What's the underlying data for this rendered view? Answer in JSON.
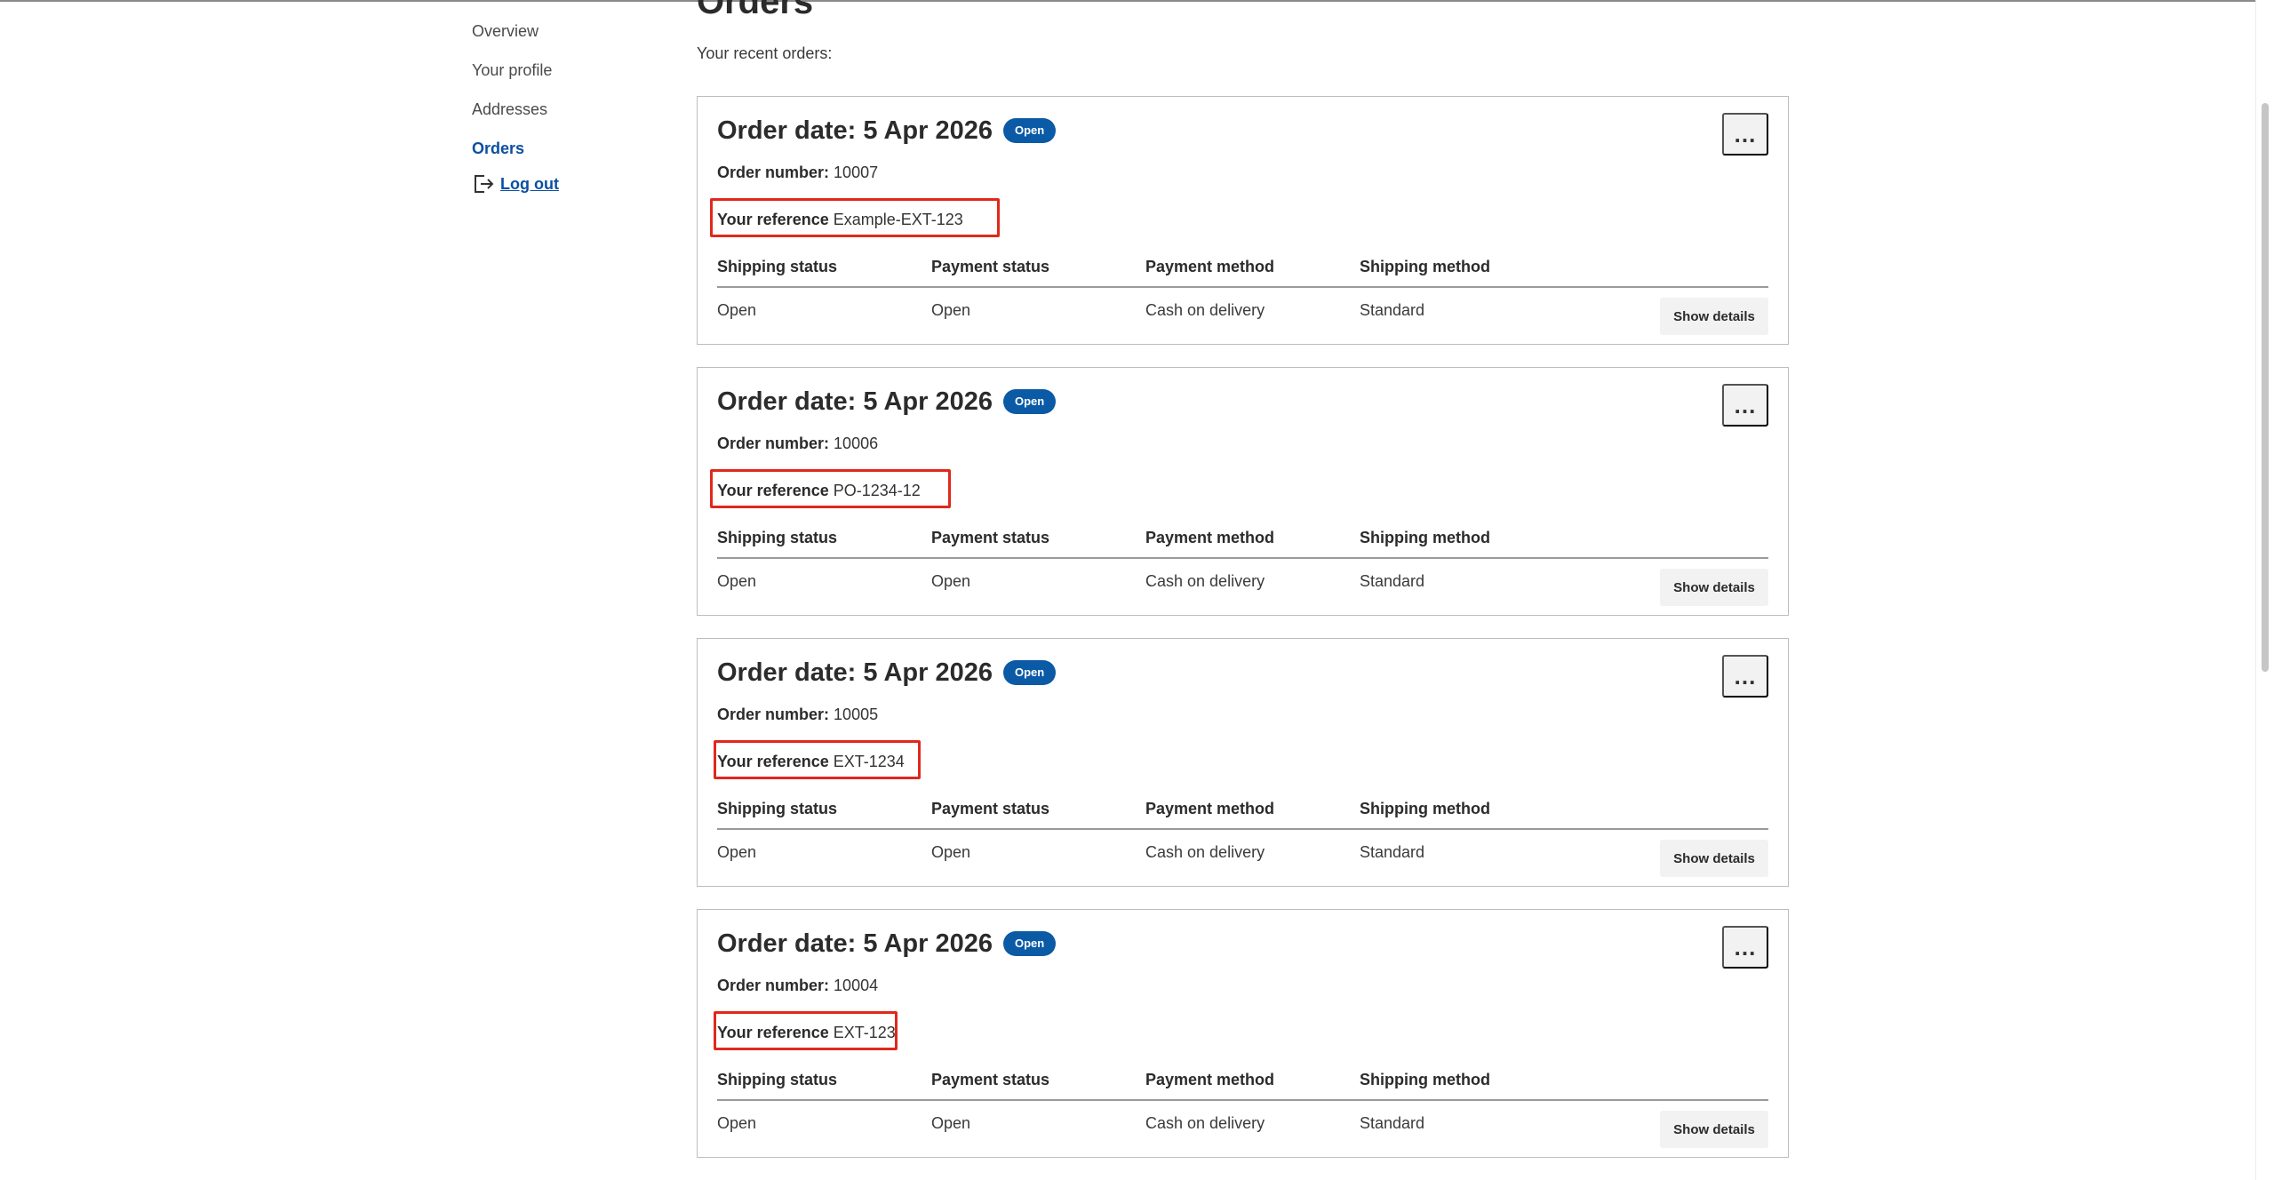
{
  "sidebar": {
    "items": [
      {
        "label": "Overview"
      },
      {
        "label": "Your profile"
      },
      {
        "label": "Addresses"
      },
      {
        "label": "Orders"
      }
    ],
    "logout_label": "Log out"
  },
  "page": {
    "title": "Orders",
    "intro": "Your recent orders:"
  },
  "labels": {
    "order_date_prefix": "Order date:",
    "order_number": "Order number:",
    "reference": "Your reference",
    "shipping_status": "Shipping status",
    "payment_status": "Payment status",
    "payment_method": "Payment method",
    "shipping_method": "Shipping method",
    "show_details": "Show details",
    "more": "…"
  },
  "orders": [
    {
      "date": "Order date: 5 Apr 2026",
      "badge": "Open",
      "number": "10007",
      "reference": "Example-EXT-123",
      "shipping_status": "Open",
      "payment_status": "Open",
      "payment_method": "Cash on delivery",
      "shipping_method": "Standard"
    },
    {
      "date": "Order date: 5 Apr 2026",
      "badge": "Open",
      "number": "10006",
      "reference": "PO-1234-12",
      "shipping_status": "Open",
      "payment_status": "Open",
      "payment_method": "Cash on delivery",
      "shipping_method": "Standard"
    },
    {
      "date": "Order date: 5 Apr 2026",
      "badge": "Open",
      "number": "10005",
      "reference": "EXT-1234",
      "shipping_status": "Open",
      "payment_status": "Open",
      "payment_method": "Cash on delivery",
      "shipping_method": "Standard"
    },
    {
      "date": "Order date: 5 Apr 2026",
      "badge": "Open",
      "number": "10004",
      "reference": "EXT-123",
      "shipping_status": "Open",
      "payment_status": "Open",
      "payment_method": "Cash on delivery",
      "shipping_method": "Standard"
    }
  ],
  "colors": {
    "accent": "#0b4fa2",
    "badge": "#0b5aa6",
    "highlight_box": "#e0281c"
  },
  "icons": {
    "logout": "logout-icon",
    "more": "more-horizontal-icon"
  }
}
